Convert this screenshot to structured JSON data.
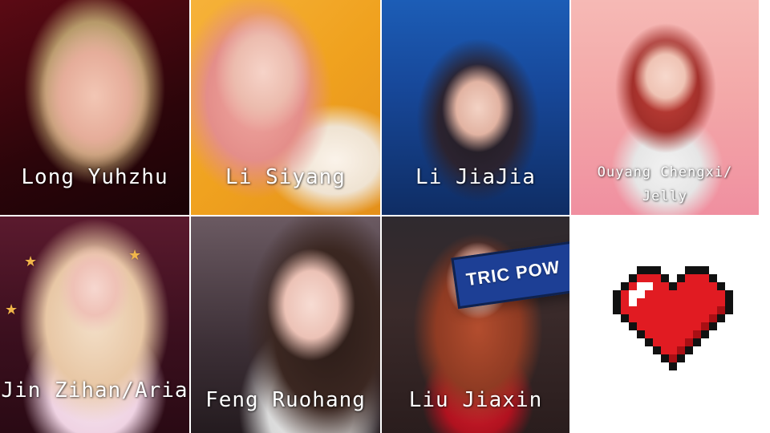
{
  "tiles": [
    {
      "caption": "Long Yuhzhu"
    },
    {
      "caption": "Li Siyang"
    },
    {
      "caption": "Li JiaJia"
    },
    {
      "caption": "Ouyang Chengxi/ Jelly"
    },
    {
      "caption": "Jin Zihan/Aria"
    },
    {
      "caption": "Feng Ruohang"
    },
    {
      "caption": "Liu Jiaxin"
    }
  ],
  "sign_text": "TRIC POW",
  "heart": {
    "icon": "pixel-heart-icon",
    "colors": {
      "outline": "#111111",
      "fill": "#e11b22",
      "shade": "#a80f14",
      "highlight": "#ffffff"
    }
  },
  "colors": {
    "caption": "#ffffff",
    "background": "#ffffff"
  }
}
